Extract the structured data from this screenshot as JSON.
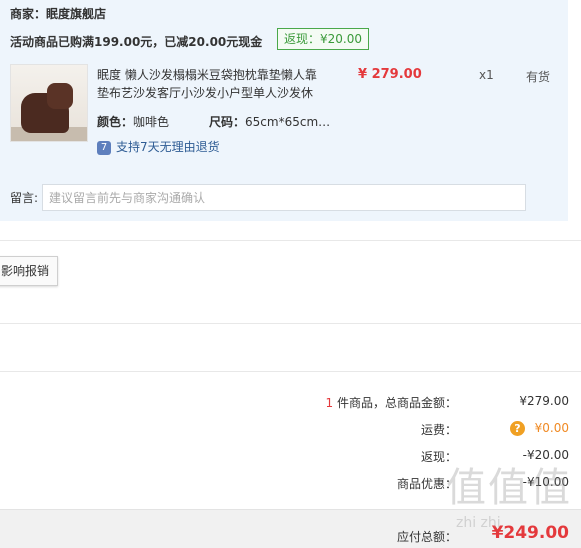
{
  "shop": {
    "seller_label": "商家：眠度旗舰店",
    "promo_text": "活动商品已购满199.00元，已减20.00元现金",
    "rebate_tag": "返现：¥20.00"
  },
  "product": {
    "name": "眠度 懒人沙发榻榻米豆袋抱枕靠垫懒人靠垫布艺沙发客厅小沙发小户型单人沙发休",
    "price": "¥ 279.00",
    "quantity": "x1",
    "stock": "有货",
    "color_key": "颜色：",
    "color_value": "咖啡色",
    "size_key": "尺码：",
    "size_value": "65cm*65cm…",
    "return_icon": "7",
    "return_policy": "支持7天无理由退货"
  },
  "message": {
    "label": "留言:",
    "placeholder": "建议留言前先与商家沟通确认"
  },
  "invoice": {
    "button_label": "影响报销"
  },
  "summary": {
    "count": "1",
    "count_label": " 件商品，总商品金额：",
    "goods_total": "¥279.00",
    "shipping_label": "运费：",
    "shipping_icon": "?",
    "shipping_value": "¥0.00",
    "cashback_label": "返现：",
    "cashback_value": "-¥20.00",
    "discount_label": "商品优惠：",
    "discount_value": "-¥10.00",
    "total_label": "应付总额：",
    "total_value": "¥249.00"
  },
  "watermark": {
    "glyphs": "值值值",
    "sub": "zhi zhi"
  }
}
